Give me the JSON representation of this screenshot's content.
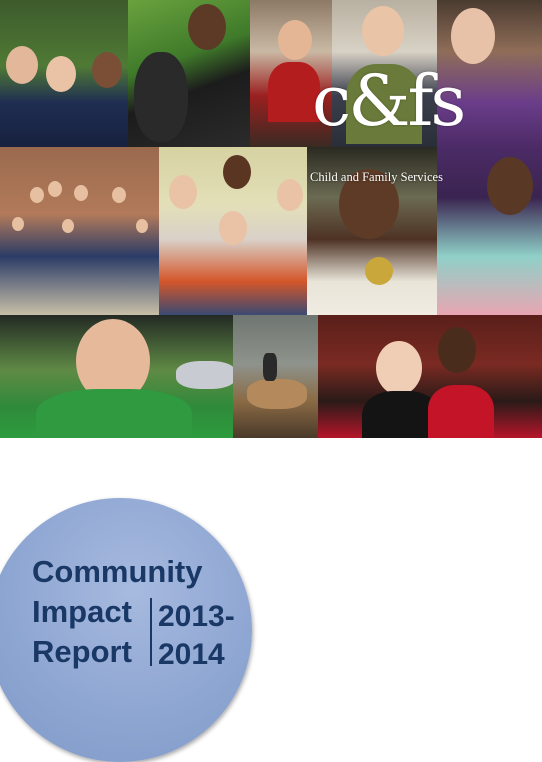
{
  "logo": {
    "mark": "c&fs",
    "subtitle": "Child and Family Services"
  },
  "title": {
    "line1": "Community",
    "line2": "Impact",
    "line3": "Report",
    "year_line1": "2013-",
    "year_line2": "2014"
  },
  "colors": {
    "title_text": "#1a3866",
    "circle": "#8ea6d2",
    "background": "#ffffff"
  }
}
